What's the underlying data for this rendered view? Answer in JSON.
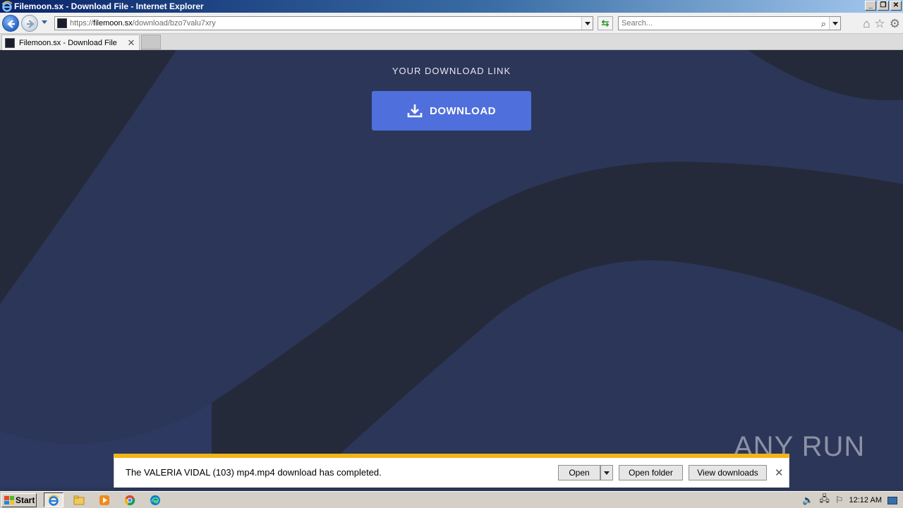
{
  "window": {
    "title": "Filemoon.sx - Download File - Internet Explorer",
    "controls": [
      "minimize",
      "restore",
      "close"
    ]
  },
  "navbar": {
    "url_prefix": "https://",
    "url_host": "filemoon.sx",
    "url_path": "/download/bzo7valu7xry",
    "search_placeholder": "Search...",
    "icons": [
      "back-icon",
      "forward-icon",
      "refresh-icon",
      "search-icon",
      "home-icon",
      "favorites-star-icon",
      "settings-gear-icon"
    ]
  },
  "tabs": [
    {
      "label": "Filemoon.sx - Download File",
      "active": true
    }
  ],
  "page": {
    "heading": "YOUR DOWNLOAD LINK",
    "download_button": "DOWNLOAD",
    "watermark": "ANY RUN",
    "colors": {
      "button": "#4f6fdc",
      "background": "#2c3658",
      "wave": "#252a3a"
    }
  },
  "notification": {
    "message": "The VALERIA VIDAL (103) mp4.mp4 download has completed.",
    "open_label": "Open",
    "open_folder_label": "Open folder",
    "view_downloads_label": "View downloads",
    "accent": "#f2b417"
  },
  "taskbar": {
    "start_label": "Start",
    "apps": [
      "internet-explorer-icon",
      "file-explorer-icon",
      "media-player-icon",
      "chrome-icon",
      "edge-icon"
    ],
    "clock": "12:12 AM"
  }
}
